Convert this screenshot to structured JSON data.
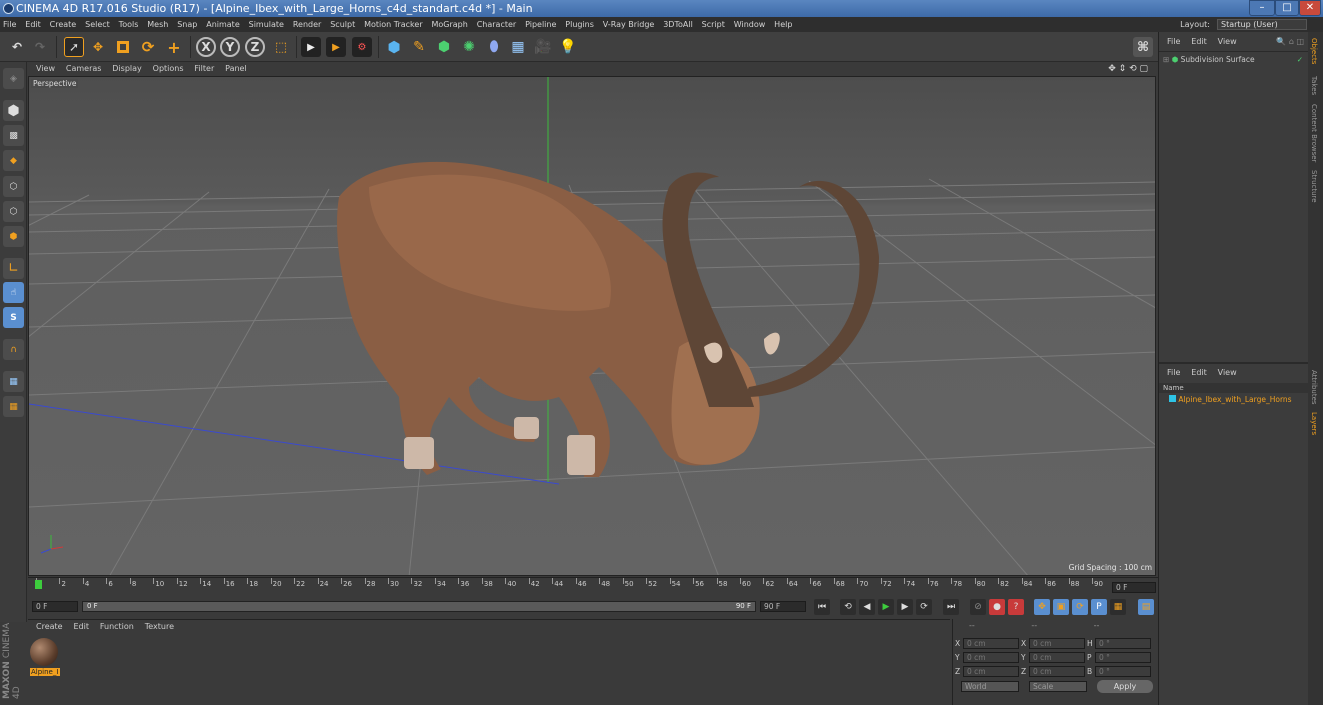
{
  "window": {
    "title": "CINEMA 4D R17.016 Studio (R17) - [Alpine_Ibex_with_Large_Horns_c4d_standart.c4d *] - Main",
    "minimize": "–",
    "maximize": "□",
    "close": "✕"
  },
  "menubar": {
    "items": [
      "File",
      "Edit",
      "Create",
      "Select",
      "Tools",
      "Mesh",
      "Snap",
      "Animate",
      "Simulate",
      "Render",
      "Sculpt",
      "Motion Tracker",
      "MoGraph",
      "Character",
      "Pipeline",
      "Plugins",
      "V-Ray Bridge",
      "3DToAll",
      "Script",
      "Window",
      "Help"
    ],
    "layout_label": "Layout:",
    "layout_value": "Startup (User)"
  },
  "toolbar": {
    "axis_x": "X",
    "axis_y": "Y",
    "axis_z": "Z"
  },
  "viewport": {
    "menu": [
      "View",
      "Cameras",
      "Display",
      "Options",
      "Filter",
      "Panel"
    ],
    "label": "Perspective",
    "grid_spacing": "Grid Spacing : 100 cm"
  },
  "timeline": {
    "ticks": [
      "0",
      "2",
      "4",
      "6",
      "8",
      "10",
      "12",
      "14",
      "16",
      "18",
      "20",
      "22",
      "24",
      "26",
      "28",
      "30",
      "32",
      "34",
      "36",
      "38",
      "40",
      "42",
      "44",
      "46",
      "48",
      "50",
      "52",
      "54",
      "56",
      "58",
      "60",
      "62",
      "64",
      "66",
      "68",
      "70",
      "72",
      "74",
      "76",
      "78",
      "80",
      "82",
      "84",
      "86",
      "88",
      "90"
    ],
    "current_frame": "0 F"
  },
  "transport": {
    "start_field": "0 F",
    "slider_start": "0 F",
    "slider_end": "90 F",
    "end_field": "90 F"
  },
  "materials": {
    "menu": [
      "Create",
      "Edit",
      "Function",
      "Texture"
    ],
    "items": [
      {
        "name": "Alpine_I"
      }
    ]
  },
  "coords": {
    "header_left": "--",
    "header_mid": "--",
    "header_right": "--",
    "rows": [
      {
        "a": "X",
        "av": "0 cm",
        "b": "X",
        "bv": "0 cm",
        "c": "H",
        "cv": "0 °"
      },
      {
        "a": "Y",
        "av": "0 cm",
        "b": "Y",
        "bv": "0 cm",
        "c": "P",
        "cv": "0 °"
      },
      {
        "a": "Z",
        "av": "0 cm",
        "b": "Z",
        "bv": "0 cm",
        "c": "B",
        "cv": "0 °"
      }
    ],
    "world": "World",
    "scale": "Scale",
    "apply": "Apply"
  },
  "objects": {
    "menu": [
      "File",
      "Edit",
      "View"
    ],
    "items": [
      {
        "name": "Subdivision Surface"
      }
    ]
  },
  "layers": {
    "menu": [
      "File",
      "Edit",
      "View"
    ],
    "column": "Name",
    "items": [
      {
        "name": "Alpine_Ibex_with_Large_Horns"
      }
    ]
  },
  "side_tabs": [
    "Objects",
    "Takes",
    "Content Browser",
    "Structure",
    "Attributes",
    "Layers"
  ],
  "brand": {
    "line1": "MAXON",
    "line2": "CINEMA 4D"
  },
  "colors": {
    "accent_orange": "#f0a020",
    "layer_cyan": "#2ec4e6",
    "active_tool_blue": "#5a8fd0"
  }
}
